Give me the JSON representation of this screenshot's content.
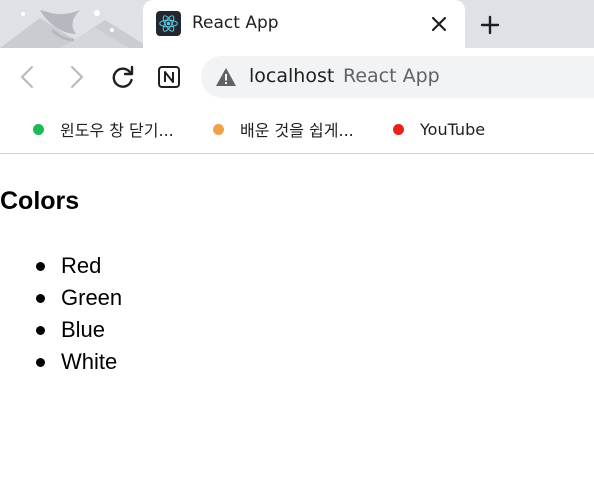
{
  "browser": {
    "tab": {
      "title": "React App",
      "favicon": "react-icon",
      "close_icon": "close-icon"
    },
    "new_tab_icon": "plus-icon",
    "toolbar": {
      "back_icon": "back-arrow-icon",
      "forward_icon": "forward-arrow-icon",
      "reload_icon": "reload-icon",
      "extension_icon": "notion-icon"
    },
    "omnibox": {
      "security_icon": "warning-triangle-icon",
      "host": "localhost",
      "page_title": "React App"
    },
    "bookmarks": [
      {
        "label": "윈도우 창 닫기...",
        "dot_color": "#1db954"
      },
      {
        "label": "배운 것을 쉽게...",
        "dot_color": "#f0a04b"
      },
      {
        "label": "YouTube",
        "dot_color": "#e62117"
      }
    ]
  },
  "page": {
    "heading": "Colors",
    "colors": [
      "Red",
      "Green",
      "Blue",
      "White"
    ]
  }
}
